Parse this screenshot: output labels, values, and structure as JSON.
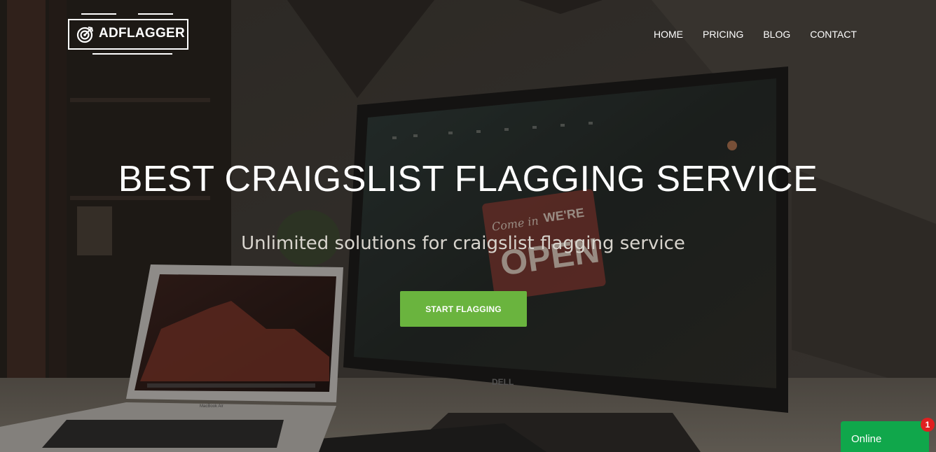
{
  "brand": {
    "logo_text": "ADFLAGGER",
    "logo_icon": "target-icon"
  },
  "nav": {
    "items": [
      {
        "label": "HOME"
      },
      {
        "label": "PRICING"
      },
      {
        "label": "BLOG"
      },
      {
        "label": "CONTACT"
      }
    ]
  },
  "hero": {
    "headline": "BEST CRAIGSLIST FLAGGING SERVICE",
    "subtitle": "Unlimited solutions for craigslist flagging service",
    "cta_label": "START FLAGGING",
    "background_scene": {
      "laptop_label": "MacBook Air",
      "monitor_brand": "DELL",
      "sign_text_script": "Come in",
      "sign_text_top": "WE'RE",
      "sign_text_main": "OPEN"
    }
  },
  "chat_widget": {
    "status_label": "Online",
    "unread_count": "1"
  },
  "colors": {
    "cta_green": "#6ab43e",
    "chat_green": "#10a74b",
    "badge_red": "#e02020",
    "text_white": "#ffffff"
  }
}
